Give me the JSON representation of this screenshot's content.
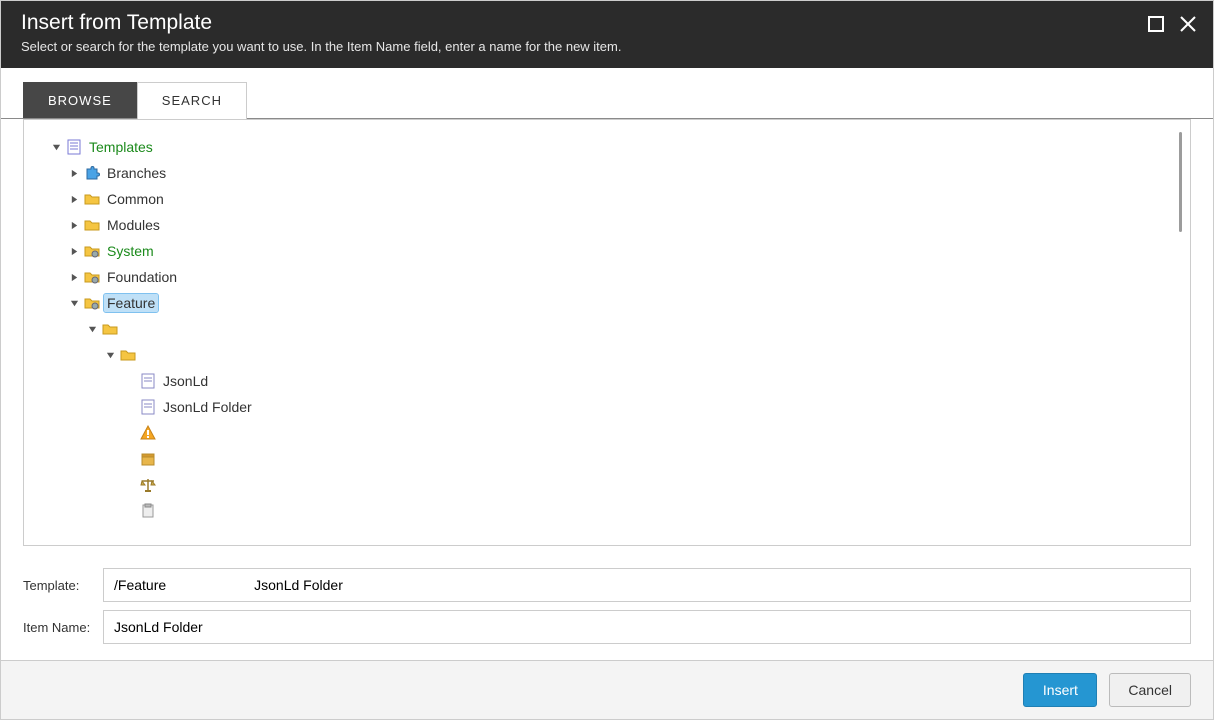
{
  "header": {
    "title": "Insert from Template",
    "subtitle": "Select or search for the template you want to use. In the Item Name field, enter a name for the new item."
  },
  "tabs": {
    "browse": "BROWSE",
    "search": "SEARCH",
    "active": "browse"
  },
  "tree": {
    "root": "Templates",
    "children": [
      {
        "label": "Branches",
        "icon": "puzzle",
        "expanded": false
      },
      {
        "label": "Common",
        "icon": "folder",
        "expanded": false
      },
      {
        "label": "Modules",
        "icon": "folder",
        "expanded": false
      },
      {
        "label": "System",
        "icon": "folder-gear",
        "expanded": false,
        "green": true
      },
      {
        "label": "Foundation",
        "icon": "folder-gear",
        "expanded": false
      },
      {
        "label": "Feature",
        "icon": "folder-gear",
        "expanded": true,
        "selected": true,
        "children": [
          {
            "label": "",
            "icon": "folder",
            "expanded": true,
            "children": [
              {
                "label": "",
                "icon": "folder",
                "expanded": true,
                "children": [
                  {
                    "label": "JsonLd",
                    "icon": "template"
                  },
                  {
                    "label": "JsonLd Folder",
                    "icon": "template"
                  },
                  {
                    "label": "",
                    "icon": "warning"
                  },
                  {
                    "label": "",
                    "icon": "box"
                  },
                  {
                    "label": "",
                    "icon": "scales"
                  },
                  {
                    "label": "",
                    "icon": "clipboard"
                  }
                ]
              }
            ]
          }
        ]
      }
    ]
  },
  "fields": {
    "template_label": "Template:",
    "template_value_a": "/Feature",
    "template_value_b": "JsonLd Folder",
    "itemname_label": "Item Name:",
    "itemname_value": "JsonLd Folder"
  },
  "footer": {
    "insert": "Insert",
    "cancel": "Cancel"
  }
}
